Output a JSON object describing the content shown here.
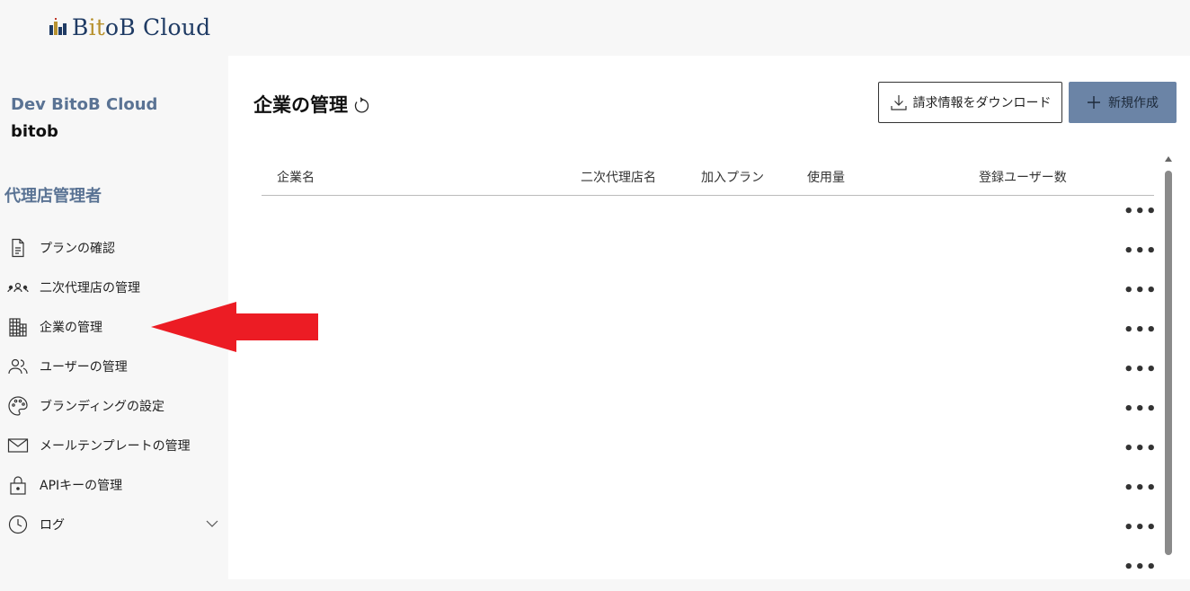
{
  "brand": {
    "logo_prefix": "B",
    "logo_accent": "it",
    "logo_suffix": "oB Cloud",
    "colors": {
      "navy": "#1f3b64",
      "gold": "#b8922f"
    }
  },
  "sidebar": {
    "tenant_name": "Dev BitoB Cloud",
    "tenant_id": "bitob",
    "role_title": "代理店管理者",
    "items": [
      {
        "label": "プランの確認",
        "icon": "document-icon"
      },
      {
        "label": "二次代理店の管理",
        "icon": "people-group-icon"
      },
      {
        "label": "企業の管理",
        "icon": "building-icon"
      },
      {
        "label": "ユーザーの管理",
        "icon": "users-icon"
      },
      {
        "label": "ブランディングの設定",
        "icon": "palette-icon"
      },
      {
        "label": "メールテンプレートの管理",
        "icon": "mail-icon"
      },
      {
        "label": "APIキーの管理",
        "icon": "lock-icon"
      },
      {
        "label": "ログ",
        "icon": "history-icon",
        "expandable": true
      }
    ]
  },
  "main": {
    "title": "企業の管理",
    "download_button": "請求情報をダウンロード",
    "new_button": "新規作成",
    "accent_color": "#6b84a6",
    "table": {
      "columns": [
        "企業名",
        "二次代理店名",
        "加入プラン",
        "使用量",
        "登録ユーザー数"
      ],
      "row_menu_label": "•••",
      "row_count": 10
    }
  },
  "annotation": {
    "arrow_color": "#ec1c24",
    "points_to": "企業の管理"
  }
}
